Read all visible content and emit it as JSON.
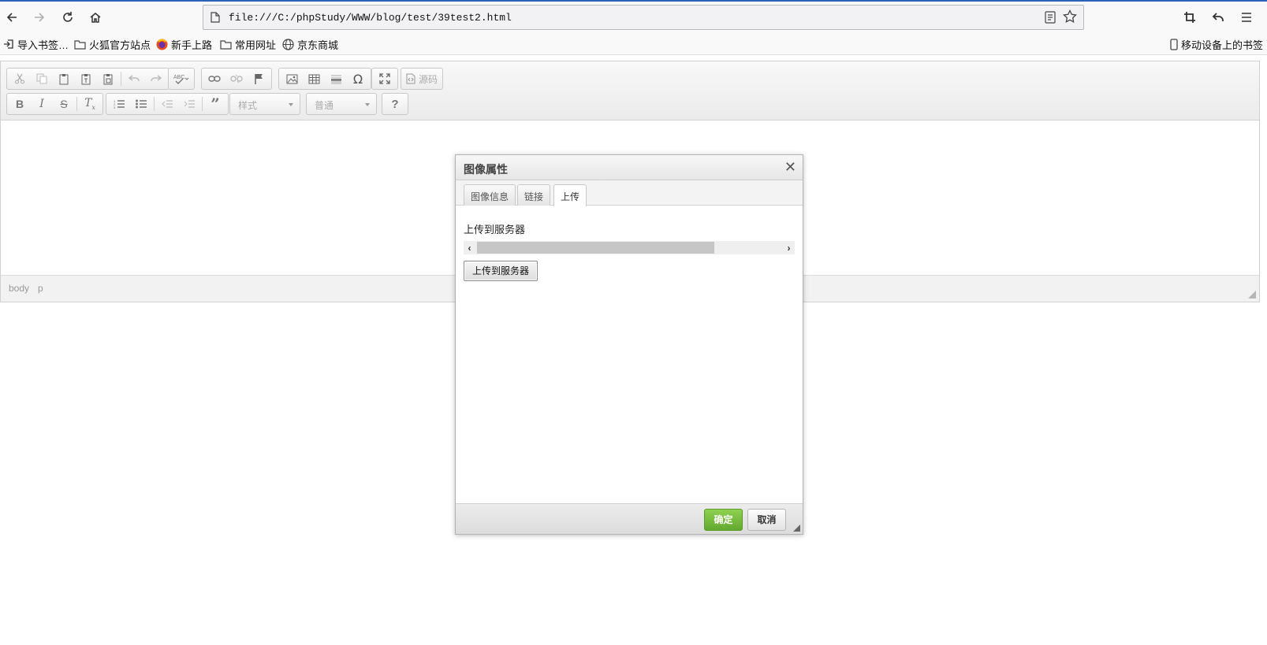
{
  "browser": {
    "url": "file:///C:/phpStudy/WWW/blog/test/39test2.html",
    "bookmarks": [
      {
        "label": "导入书签…",
        "icon": "import-icon"
      },
      {
        "label": "火狐官方站点",
        "icon": "folder-icon"
      },
      {
        "label": "新手上路",
        "icon": "firefox-icon"
      },
      {
        "label": "常用网址",
        "icon": "folder-icon"
      },
      {
        "label": "京东商城",
        "icon": "globe-icon"
      }
    ],
    "mobile_bookmarks": "移动设备上的书签"
  },
  "editor": {
    "source_label": "源码",
    "style_combo": "样式",
    "format_combo": "普通",
    "path": [
      "body",
      "p"
    ]
  },
  "dialog": {
    "title": "图像属性",
    "tabs": [
      "图像信息",
      "链接",
      "上传"
    ],
    "active_tab": "上传",
    "upload_label": "上传到服务器",
    "upload_button": "上传到服务器",
    "ok": "确定",
    "cancel": "取消"
  },
  "colors": {
    "ok_button": "#6db33f",
    "accent_border": "#2b63b6"
  }
}
